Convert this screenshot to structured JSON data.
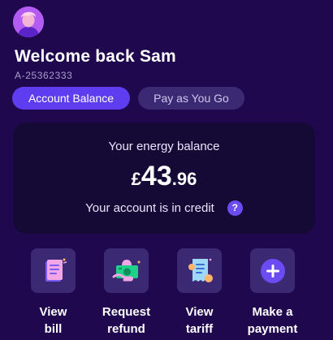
{
  "header": {
    "greeting": "Welcome back Sam",
    "account_number": "A-25362333"
  },
  "tabs": [
    {
      "label": "Account Balance",
      "active": true
    },
    {
      "label": "Pay as You Go",
      "active": false
    }
  ],
  "balance_card": {
    "label": "Your energy balance",
    "currency": "£",
    "amount_whole": "43",
    "amount_decimal": ".96",
    "status": "Your account is in credit",
    "help_icon": "?"
  },
  "actions": [
    {
      "label_line1": "View",
      "label_line2": "bill",
      "icon": "bill-icon"
    },
    {
      "label_line1": "Request",
      "label_line2": "refund",
      "icon": "refund-icon"
    },
    {
      "label_line1": "View",
      "label_line2": "tariff",
      "icon": "tariff-icon"
    },
    {
      "label_line1": "Make a",
      "label_line2": "payment",
      "icon": "add-payment-icon"
    }
  ],
  "colors": {
    "background": "#20084f",
    "card": "#150a36",
    "accent": "#5e3df0",
    "tile": "#3b2a73",
    "avatar": "#b45bf4"
  }
}
